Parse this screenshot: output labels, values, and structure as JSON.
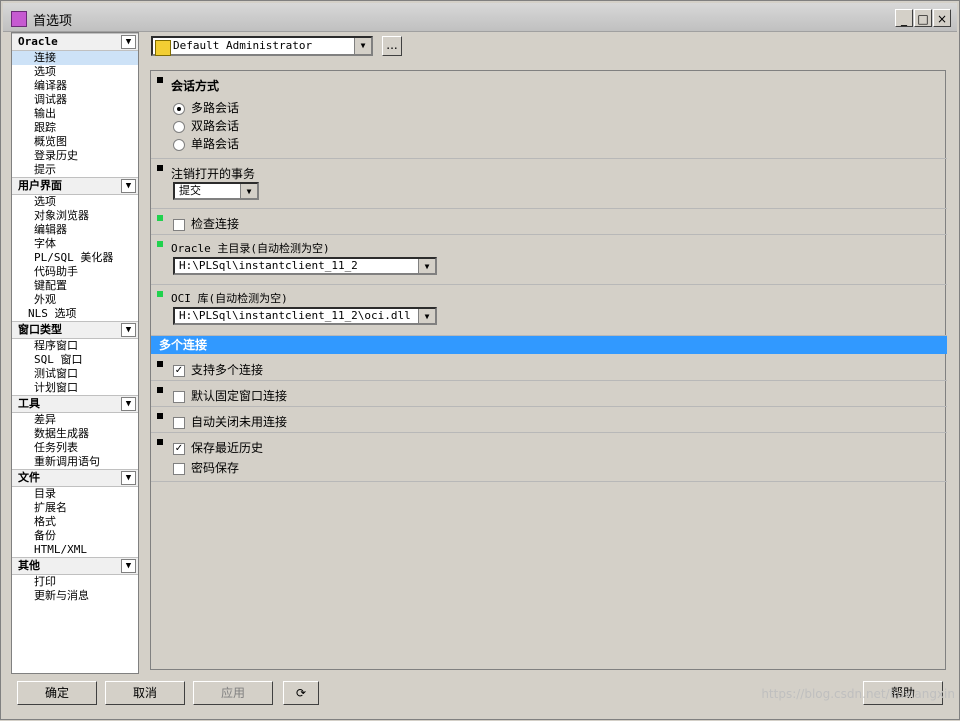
{
  "window": {
    "title": "首选项",
    "controls": [
      "_",
      "□",
      "×"
    ]
  },
  "sidebar": {
    "groups": [
      {
        "header": "Oracle",
        "items": [
          "连接",
          "选项",
          "编译器",
          "调试器",
          "输出",
          "跟踪",
          "概览图",
          "登录历史",
          "提示"
        ],
        "active": 0
      },
      {
        "header": "用户界面",
        "items": [
          "选项",
          "对象浏览器",
          "编辑器",
          "字体",
          "PL/SQL 美化器",
          "代码助手",
          "键配置",
          "外观",
          "NLS 选项"
        ]
      },
      {
        "header": "窗口类型",
        "items": [
          "程序窗口",
          "SQL 窗口",
          "测试窗口",
          "计划窗口"
        ]
      },
      {
        "header": "工具",
        "items": [
          "差异",
          "数据生成器",
          "任务列表",
          "重新调用语句"
        ]
      },
      {
        "header": "文件",
        "items": [
          "目录",
          "扩展名",
          "格式",
          "备份",
          "HTML/XML"
        ]
      },
      {
        "header": "其他",
        "items": [
          "打印",
          "更新与消息"
        ]
      }
    ]
  },
  "toolbar": {
    "profile_value": "Default Administrator",
    "ellipsis_label": "..."
  },
  "panel": {
    "session": {
      "title": "会话方式",
      "options": [
        {
          "label": "多路会话",
          "checked": true
        },
        {
          "label": "双路会话",
          "checked": false
        },
        {
          "label": "单路会话",
          "checked": false
        }
      ]
    },
    "logout_transactions": {
      "title": "注销打开的事务",
      "value": "提交"
    },
    "check_connection": {
      "label": "检查连接",
      "checked": false
    },
    "oracle_home": {
      "title": "Oracle 主目录(自动检测为空)",
      "value": "H:\\PLSql\\instantclient_11_2"
    },
    "oci_library": {
      "title": "OCI 库(自动检测为空)",
      "value": "H:\\PLSql\\instantclient_11_2\\oci.dll"
    },
    "multi_connection_bar": "多个连接",
    "multi": [
      {
        "label": "支持多个连接",
        "checked": true
      },
      {
        "label": "默认固定窗口连接",
        "checked": false
      },
      {
        "label": "自动关闭未用连接",
        "checked": false
      },
      {
        "label": "保存最近历史",
        "checked": true
      },
      {
        "label": "密码保存",
        "checked": false
      }
    ]
  },
  "footer": {
    "ok": "确定",
    "cancel": "取消",
    "apply": "应用",
    "help": "帮助",
    "watermark": "https://blog.csdn.net/liuxiangxin"
  }
}
